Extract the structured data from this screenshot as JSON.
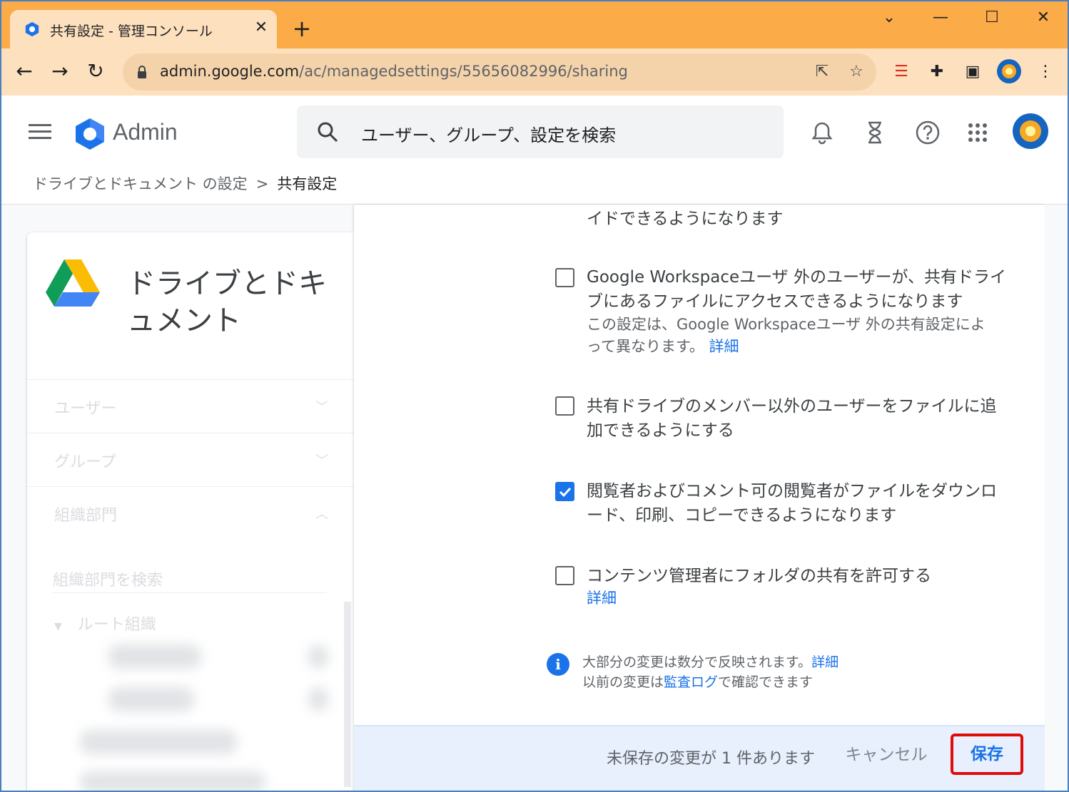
{
  "browser": {
    "tab_title": "共有設定 - 管理コンソール",
    "url_host": "admin.google.com",
    "url_path": "/ac/managedsettings/55656082996/sharing"
  },
  "header": {
    "app_title": "Admin",
    "search_placeholder": "ユーザー、グループ、設定を検索"
  },
  "breadcrumb": {
    "parent": "ドライブとドキュメント の設定",
    "separator": ">",
    "current": "共有設定"
  },
  "sidebar": {
    "product_title": "ドライブとドキュメント",
    "sections": [
      {
        "label": "ユーザー",
        "chevron": "chevron-down"
      },
      {
        "label": "グループ",
        "chevron": "chevron-down"
      },
      {
        "label": "組織部門",
        "chevron": "chevron-up"
      }
    ],
    "org_search_placeholder": "組織部門を検索",
    "org_root": "ルート組織"
  },
  "settings": {
    "partial_text": "イドできるようになります",
    "options": [
      {
        "lines": [
          "Google Workspaceユーザ 外のユーザーが、共有ドライ",
          "ブにあるファイルにアクセスできるようになります"
        ],
        "sub_lines": [
          "この設定は、Google Workspaceユーザ 外の共有設定によ",
          "って異なります。"
        ],
        "sub_link": "詳細",
        "checked": false
      },
      {
        "lines": [
          "共有ドライブのメンバー以外のユーザーをファイルに追",
          "加できるようにする"
        ],
        "checked": false
      },
      {
        "lines": [
          "閲覧者およびコメント可の閲覧者がファイルをダウンロ",
          "ード、印刷、コピーできるようになります"
        ],
        "checked": true
      },
      {
        "lines": [
          "コンテンツ管理者にフォルダの共有を許可する"
        ],
        "link": "詳細",
        "checked": false
      }
    ],
    "info": {
      "line1": "大部分の変更は数分で反映されます。",
      "line1_link": "詳細",
      "line2_pre": "以前の変更は",
      "line2_link": "監査ログ",
      "line2_post": "で確認できます"
    }
  },
  "footer": {
    "unsaved_text": "未保存の変更が 1 件あります",
    "cancel_label": "キャンセル",
    "save_label": "保存"
  },
  "colors": {
    "tabstrip": "#fbab48",
    "toolbar": "#fde0bd",
    "accent": "#1a73e8",
    "highlight_box": "#e00b0b"
  }
}
